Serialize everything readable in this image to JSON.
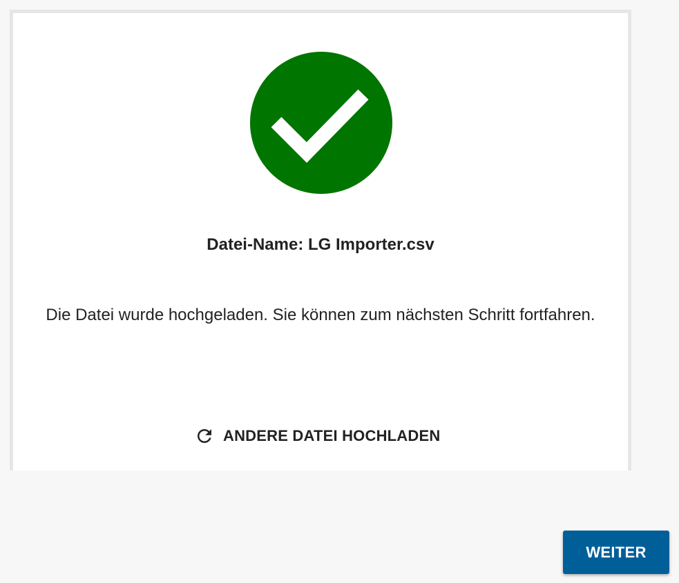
{
  "upload_result": {
    "status_icon": "check-circle-icon",
    "status_color": "#007500",
    "file_name_text": "Datei-Name: LG Importer.csv",
    "message": "Die Datei wurde hochgeladen. Sie können zum nächsten Schritt fortfahren.",
    "reupload_icon": "refresh-icon",
    "reupload_label": "ANDERE DATEI HOCHLADEN"
  },
  "footer": {
    "next_label": "WEITER",
    "next_color": "#005f99"
  }
}
